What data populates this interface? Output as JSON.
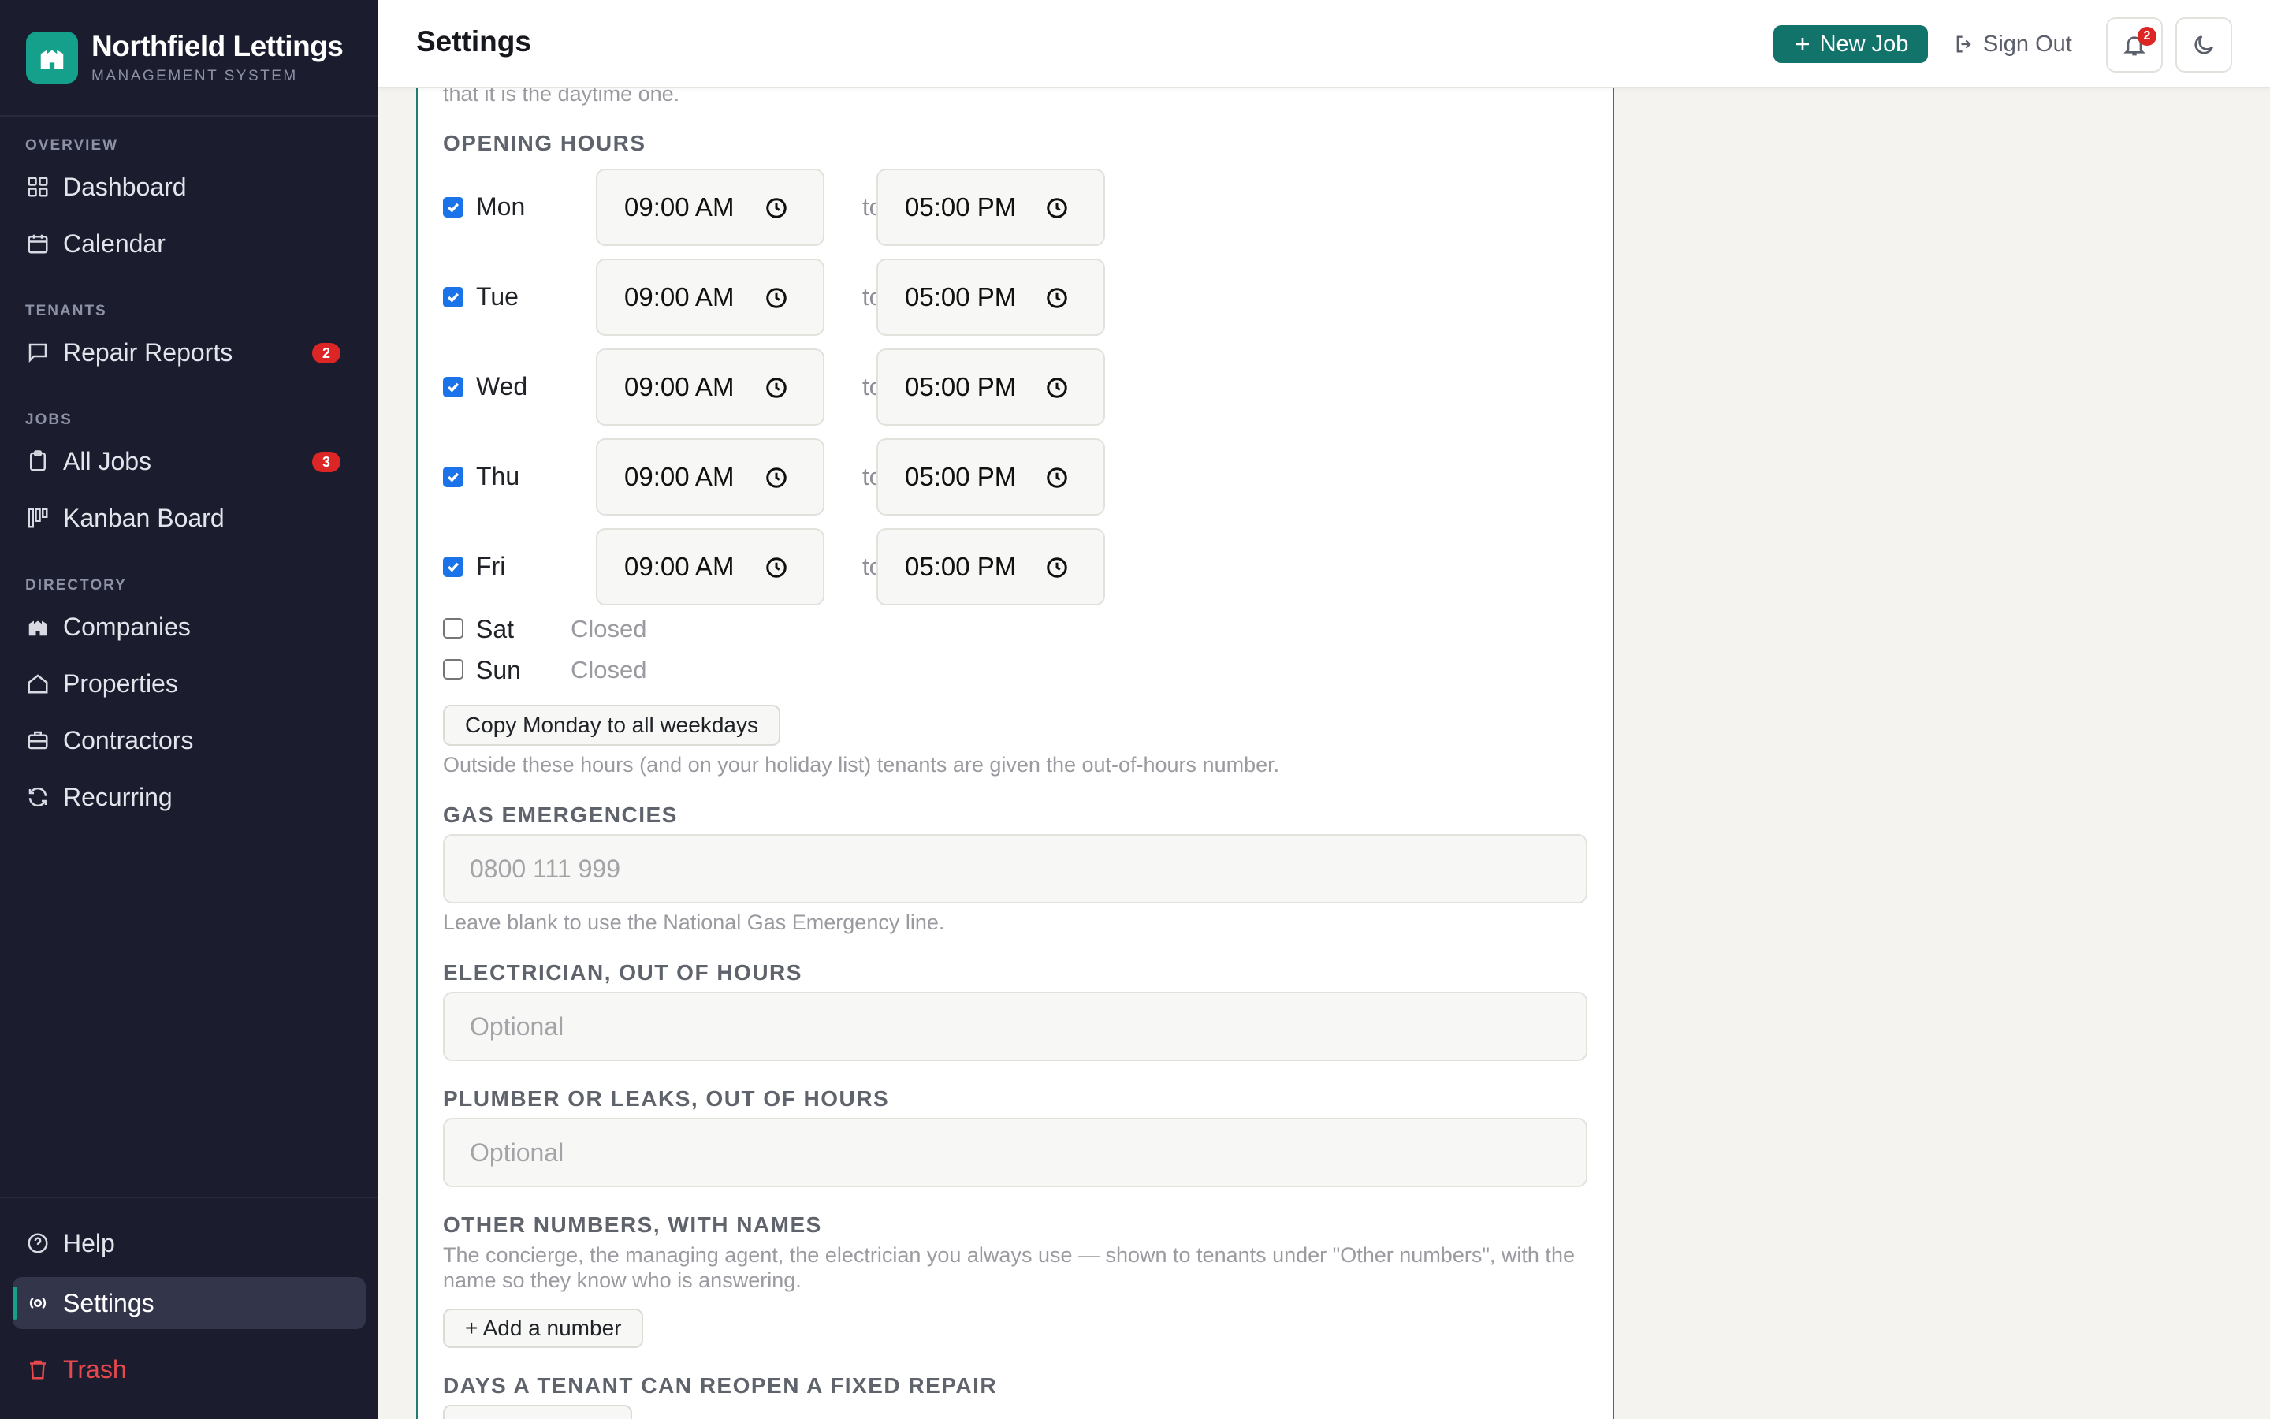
{
  "app": {
    "name": "Northfield Lettings",
    "subtitle": "MANAGEMENT SYSTEM"
  },
  "colors": {
    "accent": "#14a08a",
    "primary_button": "#12736a",
    "sidebar_bg": "#1b1d2e",
    "badge": "#dc2626",
    "danger": "#e5484d",
    "checkbox": "#1a73e8"
  },
  "sidebar": {
    "sections": {
      "overview": "OVERVIEW",
      "tenants": "TENANTS",
      "jobs": "JOBS",
      "directory": "DIRECTORY"
    },
    "items": {
      "dashboard": {
        "label": "Dashboard",
        "icon": "grid-icon"
      },
      "calendar": {
        "label": "Calendar",
        "icon": "calendar-icon"
      },
      "repair_reports": {
        "label": "Repair Reports",
        "icon": "message-icon",
        "badge": "2"
      },
      "all_jobs": {
        "label": "All Jobs",
        "icon": "clipboard-icon",
        "badge": "3"
      },
      "kanban": {
        "label": "Kanban Board",
        "icon": "kanban-icon"
      },
      "companies": {
        "label": "Companies",
        "icon": "building-icon"
      },
      "properties": {
        "label": "Properties",
        "icon": "house-icon"
      },
      "contractors": {
        "label": "Contractors",
        "icon": "briefcase-icon"
      },
      "recurring": {
        "label": "Recurring",
        "icon": "refresh-icon"
      },
      "help": {
        "label": "Help",
        "icon": "help-circle-icon"
      },
      "settings": {
        "label": "Settings",
        "icon": "settings-icon",
        "active": true
      },
      "trash": {
        "label": "Trash",
        "icon": "trash-icon"
      }
    }
  },
  "topbar": {
    "title": "Settings",
    "new_job": "New Job",
    "sign_out": "Sign Out",
    "notifications_count": "2"
  },
  "form": {
    "intro_fragment": "that it is the daytime one.",
    "opening_hours_label": "OPENING HOURS",
    "to_label": "to",
    "closed_label": "Closed",
    "days": [
      {
        "name": "Mon",
        "checked": true,
        "open": "09:00 AM",
        "close": "05:00 PM"
      },
      {
        "name": "Tue",
        "checked": true,
        "open": "09:00 AM",
        "close": "05:00 PM"
      },
      {
        "name": "Wed",
        "checked": true,
        "open": "09:00 AM",
        "close": "05:00 PM"
      },
      {
        "name": "Thu",
        "checked": true,
        "open": "09:00 AM",
        "close": "05:00 PM"
      },
      {
        "name": "Fri",
        "checked": true,
        "open": "09:00 AM",
        "close": "05:00 PM"
      },
      {
        "name": "Sat",
        "checked": false
      },
      {
        "name": "Sun",
        "checked": false
      }
    ],
    "copy_monday_button": "Copy Monday to all weekdays",
    "hours_helper": "Outside these hours (and on your holiday list) tenants are given the out-of-hours number.",
    "gas_label": "GAS EMERGENCIES",
    "gas_placeholder": "0800 111 999",
    "gas_helper": "Leave blank to use the National Gas Emergency line.",
    "electrician_label": "ELECTRICIAN, OUT OF HOURS",
    "electrician_placeholder": "Optional",
    "plumber_label": "PLUMBER OR LEAKS, OUT OF HOURS",
    "plumber_placeholder": "Optional",
    "other_numbers_label": "OTHER NUMBERS, WITH NAMES",
    "other_numbers_helper": "The concierge, the managing agent, the electrician you always use — shown to tenants under \"Other numbers\", with the name so they know who is answering.",
    "add_number_button": "+ Add a number",
    "reopen_label": "DAYS A TENANT CAN REOPEN A FIXED REPAIR"
  }
}
